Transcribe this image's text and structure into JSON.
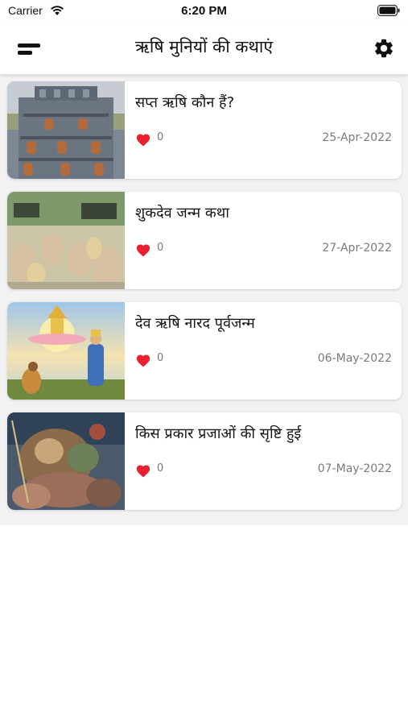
{
  "status_bar": {
    "carrier": "Carrier",
    "time": "6:20 PM",
    "wifi_icon": "wifi-icon",
    "battery_icon": "battery-icon"
  },
  "app_bar": {
    "title": "ऋषि मुनियों की कथाएं",
    "menu_icon": "menu-icon",
    "settings_icon": "gear-icon"
  },
  "theme": {
    "heart_color": "#e8202f",
    "list_background": "#f2f2f2",
    "card_background": "#ffffff"
  },
  "stories": [
    {
      "title": "सप्त ऋषि कौन हैं?",
      "likes": "0",
      "date": "25-Apr-2022",
      "image": "temple-carving-thumbnail"
    },
    {
      "title": "शुकदेव जन्म कथा",
      "likes": "0",
      "date": "27-Apr-2022",
      "image": "sages-gathering-thumbnail"
    },
    {
      "title": "देव ऋषि नारद पूर्वजन्म",
      "likes": "0",
      "date": "06-May-2022",
      "image": "narad-lotus-thumbnail"
    },
    {
      "title": "किस प्रकार प्रजाओं की सृष्टि हुई",
      "likes": "0",
      "date": "07-May-2022",
      "image": "creation-painting-thumbnail"
    }
  ]
}
